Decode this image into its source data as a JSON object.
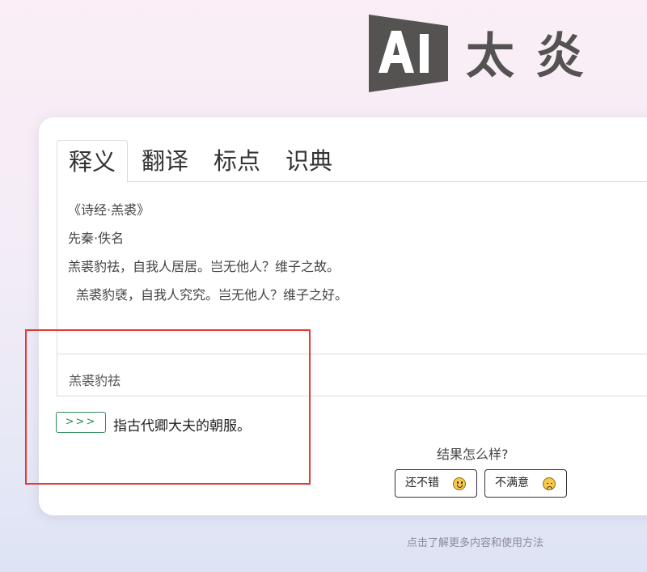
{
  "logo": {
    "text": "AI太炎",
    "chars": [
      "A",
      "I",
      "太",
      "炎"
    ],
    "color": "#555351"
  },
  "tabs": [
    {
      "label": "释义",
      "active": true
    },
    {
      "label": "翻译",
      "active": false
    },
    {
      "label": "标点",
      "active": false
    },
    {
      "label": "识典",
      "active": false
    }
  ],
  "poem": {
    "title": "《诗经·羔裘》",
    "author": "先秦·佚名",
    "line1": "羔裘豹祛，自我人居居。岂无他人？维子之故。",
    "line2": "羔裘豹褎，自我人究究。岂无他人？维子之好。"
  },
  "query": {
    "word": "羔裘豹祛"
  },
  "result": {
    "arrow_label": ">>>",
    "definition": "指古代卿大夫的朝服。"
  },
  "feedback": {
    "question": "结果怎么样?",
    "good_label": "还不错",
    "bad_label": "不满意",
    "good_icon": "smile-emoji-icon",
    "bad_icon": "sad-emoji-icon"
  },
  "footer": {
    "link": "点击了解更多内容和使用方法"
  },
  "colors": {
    "accent_green": "#2e8b57",
    "highlight_red": "#e53935",
    "emoji_yellow": "#f7c948"
  }
}
